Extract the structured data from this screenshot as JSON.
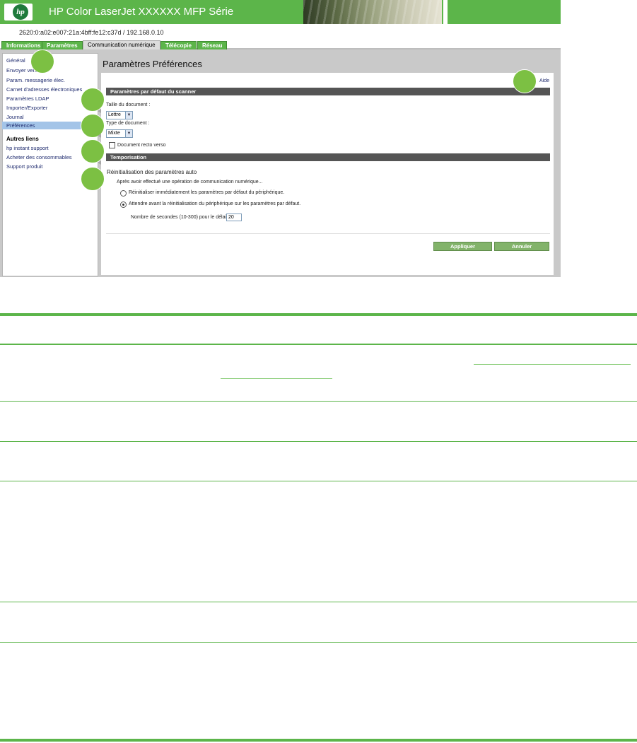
{
  "header": {
    "product_title": "HP Color LaserJet XXXXXX MFP Série",
    "address": "2620:0:a02:e007:21a:4bff:fe12:c37d / 192.168.0.10",
    "logo_text": "hp"
  },
  "tabs": [
    {
      "label": "Informations"
    },
    {
      "label": "Paramètres"
    },
    {
      "label": "Communication numérique"
    },
    {
      "label": "Télécopie"
    },
    {
      "label": "Réseau"
    }
  ],
  "sidebar": {
    "items": [
      "Général",
      "Envoyer vers...",
      "Param. messagerie élec.",
      "Carnet d'adresses électroniques",
      "Paramètres LDAP",
      "Importer/Exporter",
      "Journal",
      "Préférences"
    ],
    "selected": "Préférences",
    "other_links_title": "Autres liens",
    "other_links": [
      "hp instant support",
      "Acheter des consommables",
      "Support produit"
    ]
  },
  "main": {
    "title": "Paramètres Préférences",
    "help_link": "Aide",
    "scanner_section": {
      "title": "Paramètres par défaut du scanner",
      "doc_size_label": "Taille du document :",
      "doc_size_value": "Lettre",
      "doc_type_label": "Type de document :",
      "doc_type_value": "Mixte",
      "duplex_label": "Document recto verso",
      "duplex_checked": false
    },
    "timeout_section": {
      "title": "Temporisation",
      "subtitle": "Réinitialisation des paramètres auto",
      "intro": "Après avoir effectué une opération de communication numérique...",
      "option_immediate": "Réinitialiser immédiatement les paramètres par défaut du périphérique.",
      "option_wait": "Attendre avant la réinitialisation du périphérique sur les paramètres par défaut.",
      "selected_option": "wait",
      "seconds_label": "Nombre de secondes (10-300) pour le délai :",
      "seconds_value": "20"
    },
    "apply_button": "Appliquer",
    "cancel_button": "Annuler"
  },
  "colors": {
    "brand_green": "#5cb54a",
    "callout_green": "#7cc043",
    "section_header": "#555555",
    "selected_nav": "#a3c4e8"
  }
}
